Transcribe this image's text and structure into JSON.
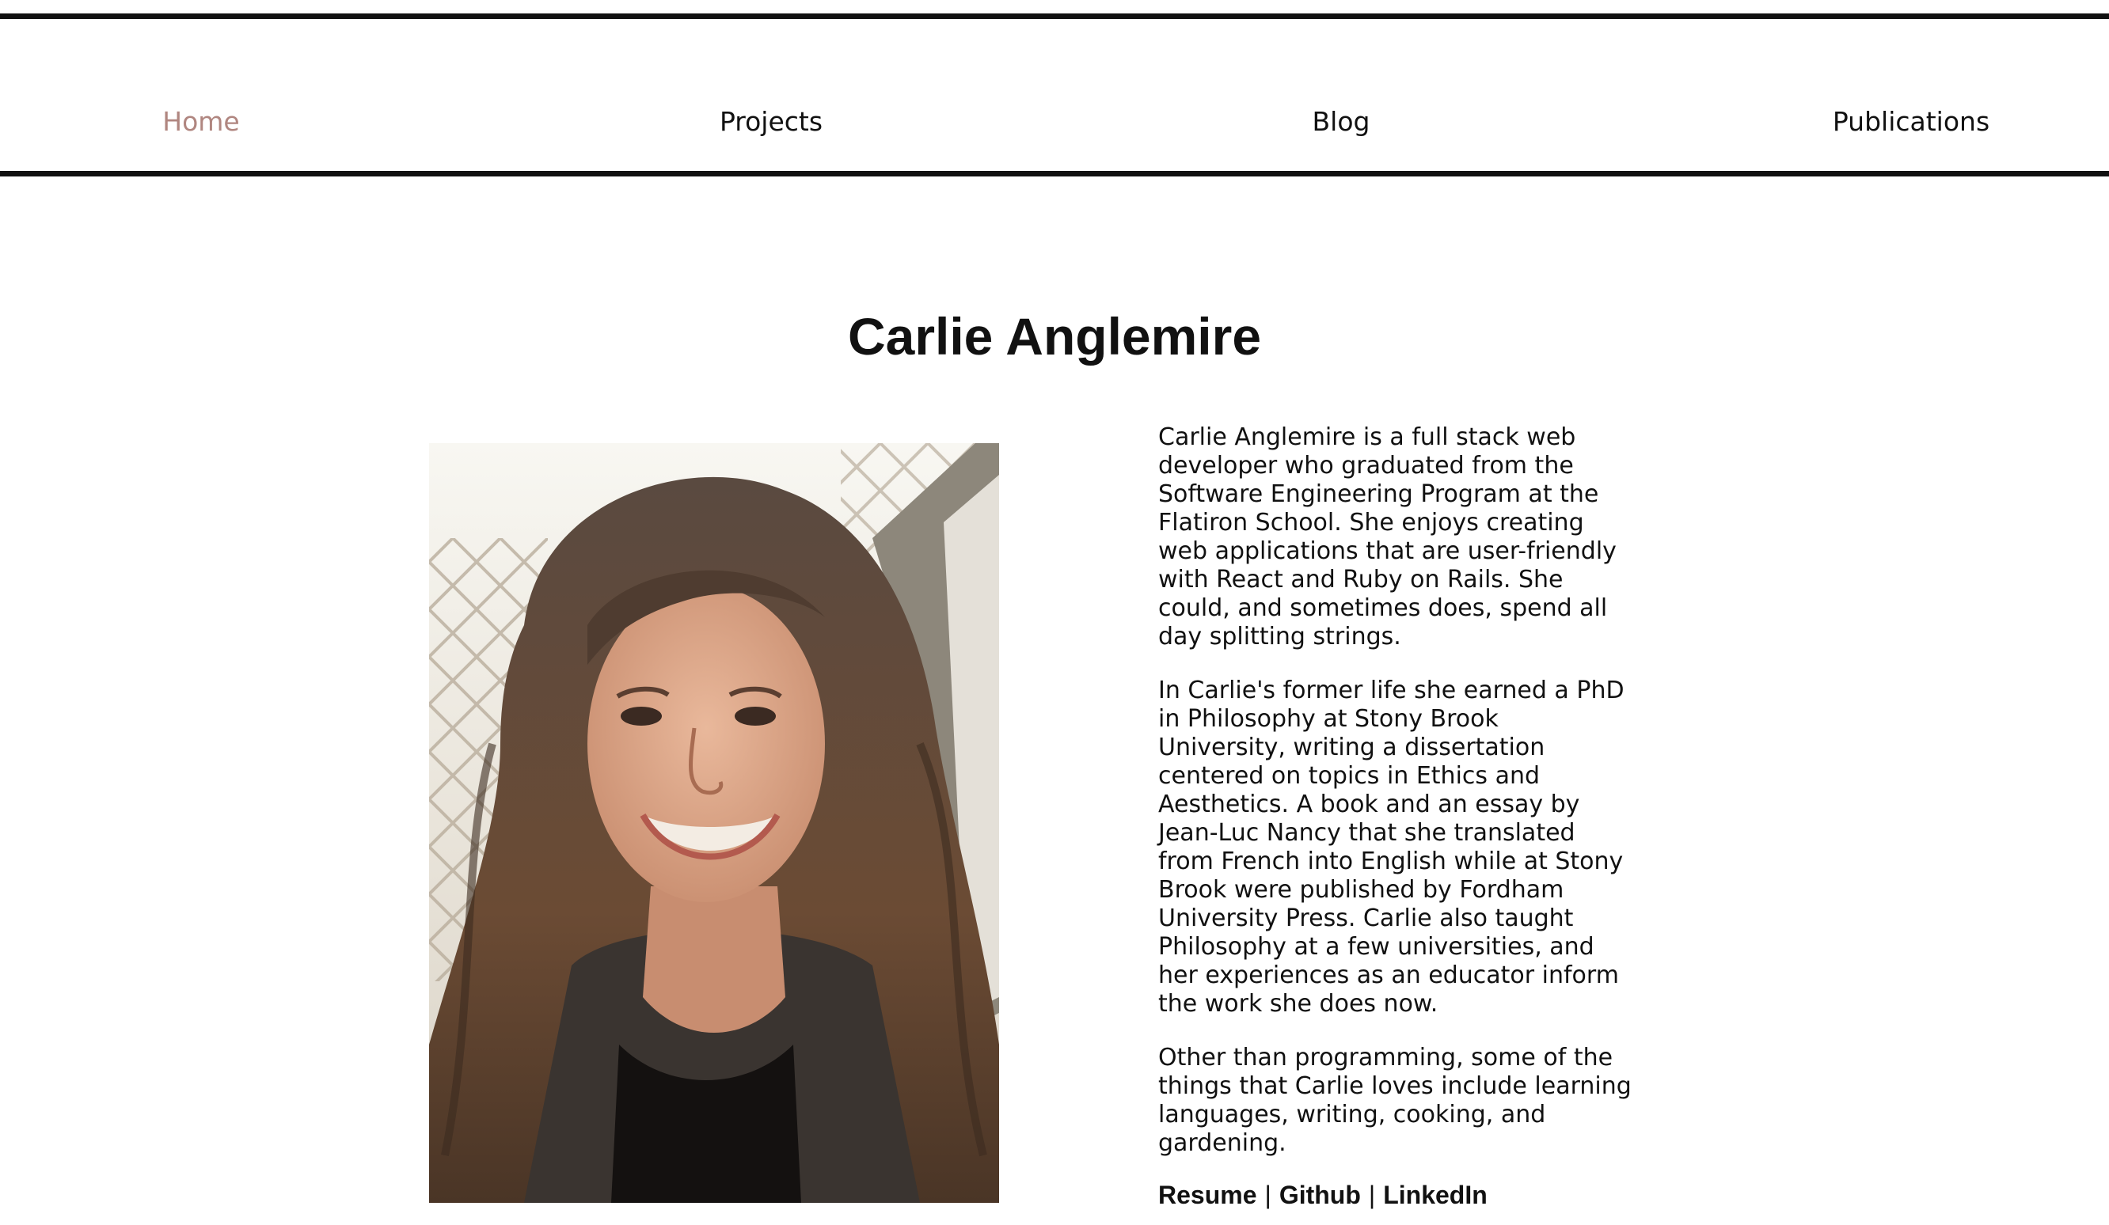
{
  "nav": {
    "items": [
      {
        "label": "Home",
        "active": true
      },
      {
        "label": "Projects",
        "active": false
      },
      {
        "label": "Blog",
        "active": false
      },
      {
        "label": "Publications",
        "active": false
      }
    ],
    "active_color": "#b08680"
  },
  "page": {
    "title": "Carlie Anglemire"
  },
  "bio": {
    "paragraphs": [
      "Carlie Anglemire is a full stack web developer who graduated from the Software Engineering Program at the Flatiron School. She enjoys creating web applications that are user-friendly with React and Ruby on Rails. She could, and sometimes does, spend all day splitting strings.",
      "In Carlie's former life she earned a PhD in Philosophy at Stony Brook University, writing a dissertation centered on topics in Ethics and Aesthetics. A book and an essay by Jean-Luc Nancy that she translated from French into English while at Stony Brook were published by Fordham University Press. Carlie also taught Philosophy at a few universities, and her experiences as an educator inform the work she does now.",
      "Other than programming, some of the things that Carlie loves include learning languages, writing, cooking, and gardening."
    ]
  },
  "links": {
    "resume": "Resume",
    "github": "Github",
    "linkedin": "LinkedIn",
    "separator": "|"
  },
  "portrait": {
    "icon": "portrait-photo"
  }
}
